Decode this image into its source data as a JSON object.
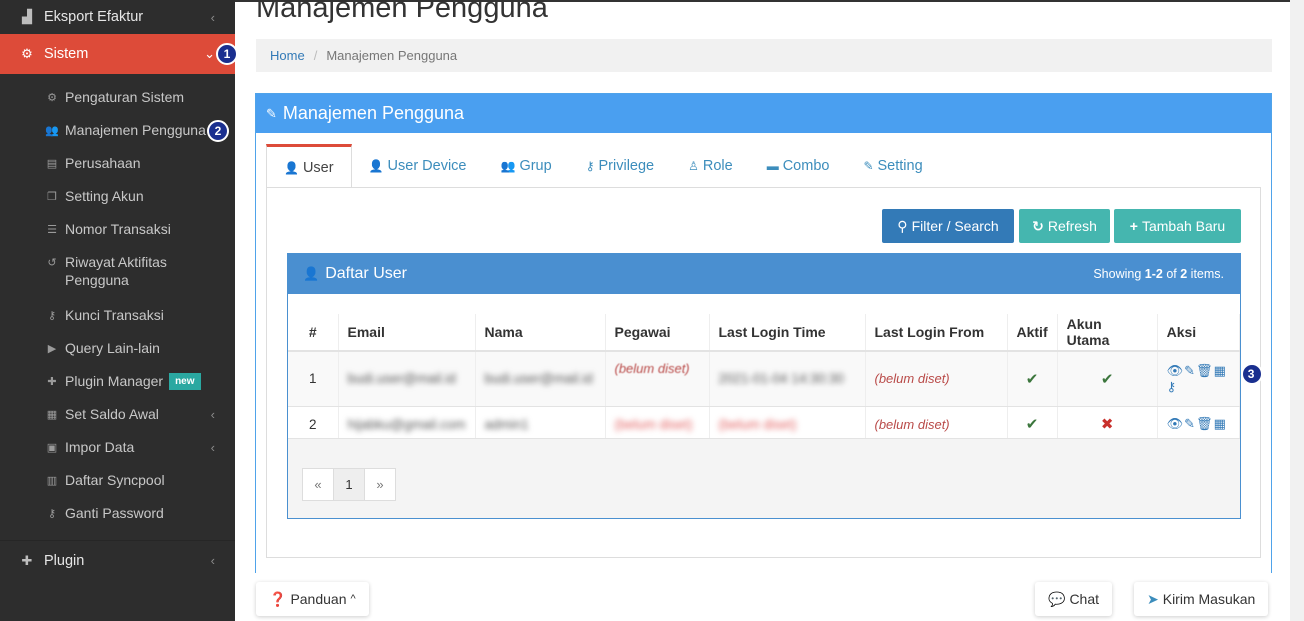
{
  "sidebar": {
    "top_item": {
      "label": "Eksport Efaktur",
      "icon": "export-icon"
    },
    "sistem": {
      "label": "Sistem",
      "icon": "cogs-icon",
      "badge": "1"
    },
    "submenu": [
      {
        "label": "Pengaturan Sistem",
        "icon": "gear-icon"
      },
      {
        "label": "Manajemen Pengguna",
        "icon": "users-icon",
        "badge": "2"
      },
      {
        "label": "Perusahaan",
        "icon": "building-icon"
      },
      {
        "label": "Setting Akun",
        "icon": "copy-icon"
      },
      {
        "label": "Nomor Transaksi",
        "icon": "list-icon"
      },
      {
        "label": "Riwayat Aktifitas Pengguna",
        "icon": "history-icon"
      },
      {
        "label": "Kunci Transaksi",
        "icon": "key-icon"
      },
      {
        "label": "Query Lain-lain",
        "icon": "play-icon"
      },
      {
        "label": "Plugin Manager",
        "icon": "puzzle-icon",
        "tag": "new"
      },
      {
        "label": "Set Saldo Awal",
        "icon": "calculator-icon"
      },
      {
        "label": "Impor Data",
        "icon": "import-icon"
      },
      {
        "label": "Daftar Syncpool",
        "icon": "calendar-icon"
      },
      {
        "label": "Ganti Password",
        "icon": "key-icon"
      }
    ],
    "plugin": {
      "label": "Plugin",
      "icon": "puzzle-icon"
    }
  },
  "page": {
    "title": "Manajemen Pengguna",
    "breadcrumb": {
      "home": "Home",
      "current": "Manajemen Pengguna"
    }
  },
  "panel": {
    "title": "Manajemen Pengguna",
    "tabs": [
      {
        "label": "User",
        "active": true
      },
      {
        "label": "User Device"
      },
      {
        "label": "Grup"
      },
      {
        "label": "Privilege"
      },
      {
        "label": "Role"
      },
      {
        "label": "Combo"
      },
      {
        "label": "Setting"
      }
    ],
    "buttons": {
      "filter": "Filter / Search",
      "refresh": "Refresh",
      "add": "Tambah Baru"
    }
  },
  "user_list": {
    "title": "Daftar User",
    "summary_prefix": "Showing ",
    "summary_range": "1-2",
    "summary_mid": " of ",
    "summary_total": "2",
    "summary_suffix": " items.",
    "columns": [
      "#",
      "Email",
      "Nama",
      "Pegawai",
      "Last Login Time",
      "Last Login From",
      "Aktif",
      "Akun Utama",
      "Aksi"
    ],
    "rows": [
      {
        "num": "1",
        "email": "",
        "nama": "",
        "pegawai": "(belum diset)",
        "last_login_time": "",
        "last_login_from": "(belum diset)",
        "aktif": "✔",
        "akun_utama": "✔",
        "badge": "3"
      },
      {
        "num": "2",
        "email": "",
        "nama": "",
        "pegawai": "",
        "last_login_time": "",
        "last_login_from": "(belum diset)",
        "aktif": "✔",
        "akun_utama": "✖"
      }
    ],
    "pager": {
      "prev": "«",
      "page": "1",
      "next": "»"
    }
  },
  "bottom": {
    "panduan": "Panduan",
    "chat": "Chat",
    "kirim": "Kirim Masukan"
  }
}
